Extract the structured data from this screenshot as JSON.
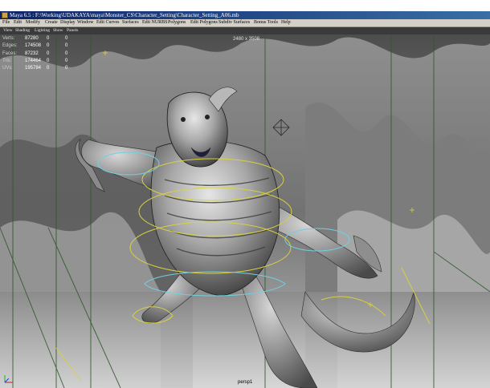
{
  "window": {
    "title": "Maya 6.5 : F:\\Working\\UDAKAYA\\maya\\Monster_CS\\Character_Setting\\Character_Setting_A06.mb"
  },
  "menubar": {
    "items": [
      "File",
      "Edit",
      "Modify",
      "Create",
      "Display",
      "Window",
      "Edit Curves",
      "Surfaces",
      "Edit NURBS",
      "Polygons",
      "Edit Polygons",
      "Subdiv Surfaces",
      "Bonus Tools",
      "Help"
    ]
  },
  "panel_menu": {
    "items": [
      "View",
      "Shading",
      "Lighting",
      "Show",
      "Panels"
    ]
  },
  "hud": {
    "stats": [
      {
        "label": "Verts:",
        "value": "87280",
        "sel": "0",
        "comp": "0"
      },
      {
        "label": "Edges:",
        "value": "174508",
        "sel": "0",
        "comp": "0"
      },
      {
        "label": "Faces:",
        "value": "87232",
        "sel": "0",
        "comp": "0"
      },
      {
        "label": "Tris:",
        "value": "174464",
        "sel": "0",
        "comp": "0"
      },
      {
        "label": "UVs:",
        "value": "195784",
        "sel": "0",
        "comp": "0"
      }
    ],
    "resolution": "2480 x 3508",
    "camera": "persp1"
  },
  "colors": {
    "titlebar_start": "#0a246a",
    "titlebar_end": "#3a6ea5",
    "menubar_bg": "#d4d0c8",
    "viewport_bg": "#6a6a6a",
    "grid_line": "#2f5a2a",
    "curve_yellow": "#d8d040",
    "curve_cyan": "#6fd0e0"
  },
  "icons": {
    "app": "maya-app-icon",
    "axis": "view-axis-icon"
  }
}
